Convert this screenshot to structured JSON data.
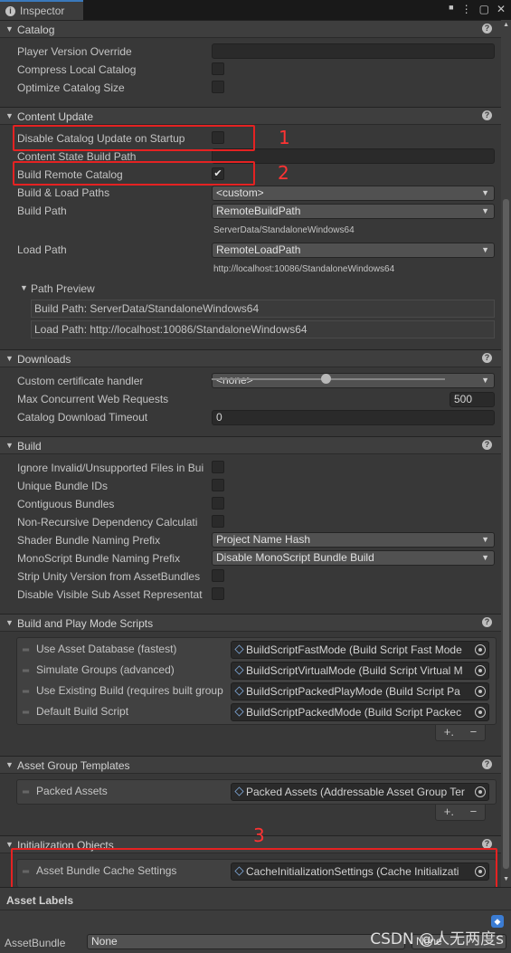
{
  "window": {
    "tab_title": "Inspector",
    "tab_icon": "info-icon",
    "menu_glyph": "⋮",
    "lock_glyph": "🔒",
    "maximize_glyph": "▢",
    "close_glyph": "✕"
  },
  "sections": {
    "catalog": {
      "title": "Catalog",
      "player_version_override": "Player Version Override",
      "compress_local_catalog": "Compress Local Catalog",
      "optimize_catalog_size": "Optimize Catalog Size"
    },
    "content_update": {
      "title": "Content Update",
      "disable_catalog_update": "Disable Catalog Update on Startup",
      "content_state_build_path": "Content State Build Path",
      "build_remote_catalog": "Build Remote Catalog",
      "build_remote_catalog_checked": "✔",
      "build_load_paths": "Build & Load Paths",
      "build_load_paths_value": "<custom>",
      "build_path": "Build Path",
      "build_path_value": "RemoteBuildPath",
      "build_path_resolved": "ServerData/StandaloneWindows64",
      "load_path": "Load Path",
      "load_path_value": "RemoteLoadPath",
      "load_path_resolved": "http://localhost:10086/StandaloneWindows64",
      "path_preview": "Path Preview",
      "preview_build": "Build Path: ServerData/StandaloneWindows64",
      "preview_load": "Load Path: http://localhost:10086/StandaloneWindows64"
    },
    "downloads": {
      "title": "Downloads",
      "custom_cert": "Custom certificate handler",
      "custom_cert_value": "<none>",
      "max_concurrent": "Max Concurrent Web Requests",
      "max_concurrent_value": "500",
      "max_concurrent_level": 0.5,
      "catalog_timeout": "Catalog Download Timeout",
      "catalog_timeout_value": "0"
    },
    "build": {
      "title": "Build",
      "ignore_invalid": "Ignore Invalid/Unsupported Files in Bui",
      "unique_bundle_ids": "Unique Bundle IDs",
      "contiguous_bundles": "Contiguous Bundles",
      "non_recursive": "Non-Recursive Dependency Calculati",
      "shader_prefix": "Shader Bundle Naming Prefix",
      "shader_prefix_value": "Project Name Hash",
      "monoscript_prefix": "MonoScript Bundle Naming Prefix",
      "monoscript_prefix_value": "Disable MonoScript Bundle Build",
      "strip_unity_version": "Strip Unity Version from AssetBundles",
      "disable_visible_sub": "Disable Visible Sub Asset Representat"
    },
    "play_mode_scripts": {
      "title": "Build and Play Mode Scripts",
      "items": [
        {
          "label": "Use Asset Database (fastest)",
          "value": "BuildScriptFastMode (Build Script Fast Mode"
        },
        {
          "label": "Simulate Groups (advanced)",
          "value": "BuildScriptVirtualMode (Build Script Virtual M"
        },
        {
          "label": "Use Existing Build (requires built group",
          "value": "BuildScriptPackedPlayMode (Build Script Pa"
        },
        {
          "label": "Default Build Script",
          "value": "BuildScriptPackedMode (Build Script Packec"
        }
      ]
    },
    "group_templates": {
      "title": "Asset Group Templates",
      "items": [
        {
          "label": "Packed Assets",
          "value": "Packed Assets (Addressable Asset Group Ter"
        }
      ]
    },
    "init_objects": {
      "title": "Initialization Objects",
      "items": [
        {
          "label": "Asset Bundle Cache Settings",
          "value": "CacheInitializationSettings (Cache Initializati"
        }
      ]
    }
  },
  "list_buttons": {
    "plus": "+.",
    "minus": "−"
  },
  "help_glyph": "?",
  "annotations": {
    "one": "1",
    "two": "2",
    "three": "3"
  },
  "asset_labels": {
    "title": "Asset Labels",
    "assetbundle_label": "AssetBundle",
    "assetbundle_value": "None",
    "variant_value": "None",
    "watermark": "CSDN @人无两度s"
  }
}
